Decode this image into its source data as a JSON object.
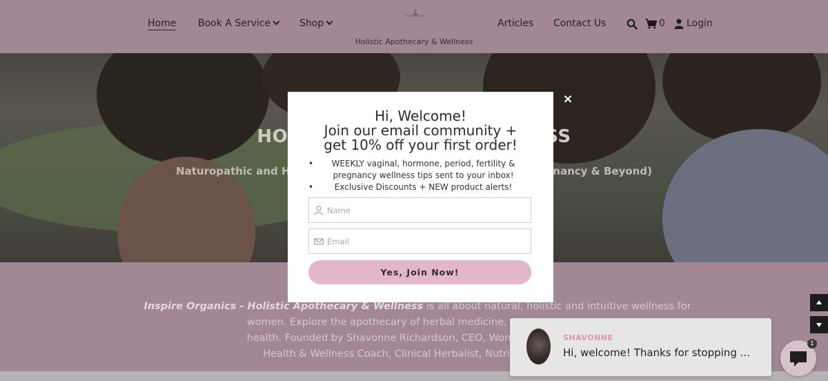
{
  "header": {
    "nav": {
      "home": "Home",
      "book": "Book A Service",
      "shop": "Shop",
      "articles": "Articles",
      "contact": "Contact Us"
    },
    "tagline": "Holistic Apothecary & Wellness",
    "cart_count": "0",
    "login": "Login",
    "icons": [
      "search-icon",
      "cart-icon",
      "user-icon"
    ]
  },
  "hero": {
    "title_left": "HOLIS",
    "title_right": "NESS",
    "subtitle_left": "Naturopathic and H",
    "subtitle_right": "gnancy & Beyond)"
  },
  "about": {
    "brand": "Inspire Organics - Holistic Apothecary & Wellness",
    "text_after_brand": " is all about natural, holistic and intuitive wellness for women. Explore the apothecary of herbal medicine, supplements ar",
    "line3": "health. Founded by Shavonne Richardson, CEO, Women's Naturopat",
    "line4": "Health & Wellness Coach, Clinical Herbalist, Nutritionist and F"
  },
  "modal": {
    "title_line1": "Hi, Welcome!",
    "title_line2": "Join our email community +",
    "title_line3": "get 10% off your first order!",
    "bullets": [
      "WEEKLY vaginal, hormone, period, fertility & pregnancy wellness tips sent to your inbox!",
      "Exclusive Discounts + NEW product alerts!"
    ],
    "name_placeholder": "Name",
    "email_placeholder": "Email",
    "button": "Yes, Join Now!",
    "close": "×"
  },
  "chat": {
    "name": "SHAVONNE",
    "message": "Hi, welcome! Thanks for stopping ...",
    "badge": "1"
  },
  "colors": {
    "accent_pink": "#e3b6c9",
    "header_bg": "#a28794",
    "chat_name": "#d89aa8"
  }
}
